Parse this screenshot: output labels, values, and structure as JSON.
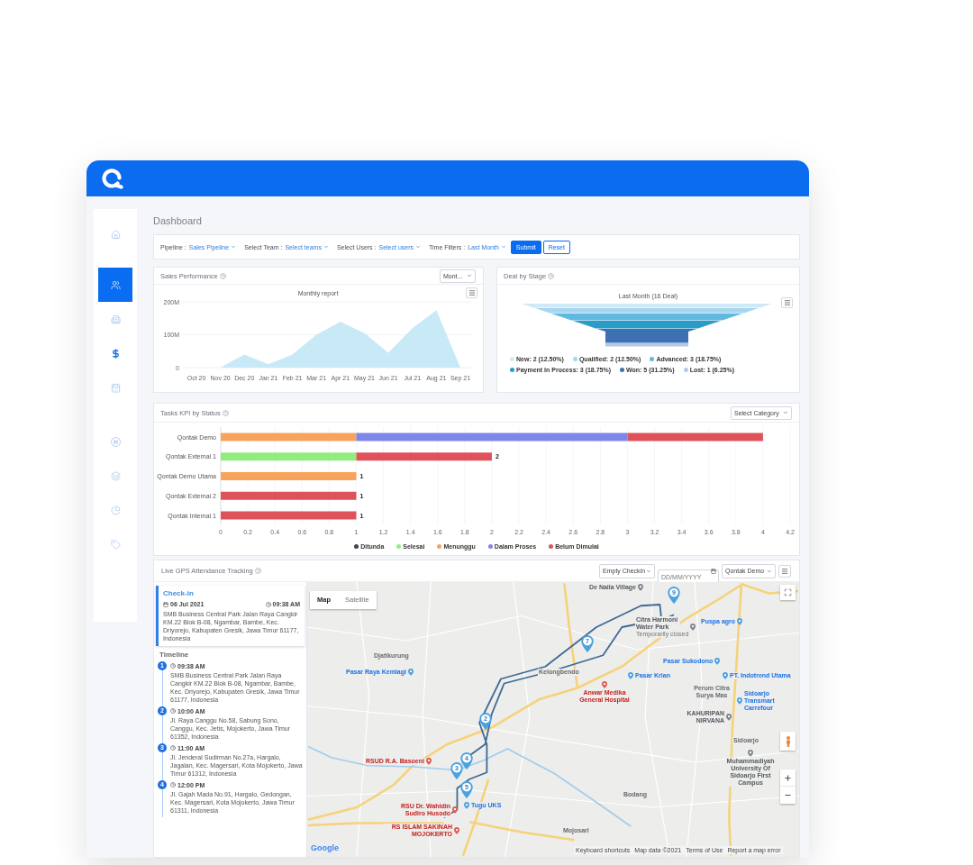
{
  "sidebar": {
    "items": [
      {
        "kind": "home",
        "selected": false
      },
      {
        "kind": "users",
        "selected": true
      },
      {
        "kind": "building",
        "selected": false
      },
      {
        "kind": "dollar",
        "selected": false
      },
      {
        "kind": "calendar",
        "selected": false
      },
      {
        "kind": "list",
        "selected": false
      },
      {
        "kind": "layers",
        "selected": false
      },
      {
        "kind": "pie",
        "selected": false
      },
      {
        "kind": "tag",
        "selected": false
      }
    ]
  },
  "page_title": "Dashboard",
  "filters": {
    "fields": [
      {
        "label": "Pipeline :",
        "value": "Sales Pipeline"
      },
      {
        "label": "Select Team :",
        "value": "Select teams"
      },
      {
        "label": "Select Users :",
        "value": "Select users"
      },
      {
        "label": "Time Filters :",
        "value": "Last Month"
      }
    ],
    "buttons": [
      {
        "label": "Submit",
        "kind": "primary"
      },
      {
        "label": "Reset",
        "kind": "secondary"
      }
    ]
  },
  "sales_performance": {
    "title": "Sales Performance",
    "period_select": "Mont...",
    "chart_data": {
      "type": "area",
      "title": "Monthly report",
      "categories": [
        "Oct 20",
        "Nov 20",
        "Dec 20",
        "Jan 21",
        "Feb 21",
        "Mar 21",
        "Apr 21",
        "May 21",
        "Jun 21",
        "Jul 21",
        "Aug 21",
        "Sep 21"
      ],
      "series": [
        {
          "color": "#c8e9f6",
          "values": [
            0,
            0,
            40,
            10,
            40,
            100,
            140,
            105,
            45,
            120,
            175,
            0
          ]
        }
      ],
      "ylim": [
        0,
        200
      ],
      "yticks": [
        {
          "value": 0,
          "label": "0"
        },
        {
          "value": 100,
          "label": "100M"
        },
        {
          "value": 200,
          "label": "200M"
        }
      ],
      "grid": true
    }
  },
  "deal_by_stage": {
    "title": "Deal by Stage",
    "chart_title": "Last Month (16 Deal)",
    "stages": [
      {
        "label": "New: 2 (12.50%)",
        "color": "#cfe9f7"
      },
      {
        "label": "Qualified: 2 (12.50%)",
        "color": "#a6d7f0"
      },
      {
        "label": "Advanced: 3 (18.75%)",
        "color": "#62b9e0"
      },
      {
        "label": "Payment In Process: 3 (18.75%)",
        "color": "#2b9cc8"
      },
      {
        "label": "Won: 5 (31.25%)",
        "color": "#3d71b3"
      },
      {
        "label": "Lost: 1 (6.25%)",
        "color": "#b6c9e4"
      }
    ]
  },
  "tasks_kpi": {
    "title": "Tasks KPI by Status",
    "category_select": "Select Category",
    "chart_data": {
      "type": "bar",
      "orientation": "horizontal",
      "stacked": true,
      "categories": [
        "Qontak Demo",
        "Qontak External 1",
        "Qontak Demo Utama",
        "Qontak External 2",
        "Qontak Internal 1"
      ],
      "series": [
        {
          "name": "Ditunda",
          "color": "#434348",
          "values": [
            0,
            0,
            0,
            0,
            0
          ]
        },
        {
          "name": "Selesai",
          "color": "#90ed7d",
          "values": [
            0,
            1,
            0,
            0,
            0
          ]
        },
        {
          "name": "Menunggu",
          "color": "#f7a35c",
          "values": [
            1,
            0,
            1,
            0,
            0
          ]
        },
        {
          "name": "Dalam Proses",
          "color": "#8085e9",
          "values": [
            2,
            0,
            0,
            0,
            0
          ]
        },
        {
          "name": "Belum Dimulai",
          "color": "#e0525a",
          "values": [
            1,
            1,
            0,
            1,
            1
          ]
        }
      ],
      "xlim": [
        0,
        4.2
      ],
      "xticks": [
        0,
        0.2,
        0.4,
        0.6,
        0.8,
        1,
        1.2,
        1.4,
        1.6,
        1.8,
        2,
        2.2,
        2.4,
        2.6,
        2.8,
        3,
        3.2,
        3.4,
        3.6,
        3.8,
        4,
        4.2
      ],
      "value_labels": [
        null,
        "2",
        "1",
        "1",
        "1"
      ],
      "grid": true
    }
  },
  "gps_tracking": {
    "title": "Live GPS Attendance Tracking",
    "checkin_filter": "Empty Checkin",
    "date_field": {
      "placeholder": "DD/MM/YYYY"
    },
    "user_select": "Qontak Demo",
    "checkin": {
      "title": "Check-in",
      "date": "06 Jul 2021",
      "time": "09:38 AM",
      "address": "SMB Business Central Park Jalan Raya Cangkir KM.22 Blok B-08, Ngambar, Bambe, Kec. Driyorejo, Kabupaten Gresik, Jawa Timur 61177, Indonesia"
    },
    "timeline": {
      "title": "Timeline",
      "entries": [
        {
          "number": "1",
          "time": "09:38 AM",
          "address": "SMB Business Central Park Jalan Raya Cangkir KM.22 Blok B-08, Ngambar, Bambe, Kec. Driyorejo, Kabupaten Gresik, Jawa Timur 61177, Indonesia"
        },
        {
          "number": "2",
          "time": "10:00 AM",
          "address": "Jl. Raya Canggu No.58, Sabung Sono, Canggu, Kec. Jetis, Mojokerto, Jawa Timur 61352, Indonesia"
        },
        {
          "number": "3",
          "time": "11:00 AM",
          "address": "Jl. Jenderal Sudirman No.27a, Hargalo, Jagalan, Kec. Magersari, Kota Mojokerto, Jawa Timur 61312, Indonesia"
        },
        {
          "number": "4",
          "time": "12:00 PM",
          "address": "Jl. Gajah Mada No.91, Hargalo, Gedongan, Kec. Magersari, Kota Mojokerto, Jawa Timur 61311, Indonesia"
        }
      ]
    },
    "map": {
      "tabs": [
        {
          "label": "Map",
          "selected": true
        },
        {
          "label": "Satellite",
          "selected": false
        }
      ],
      "places": [
        {
          "name": "De Naila Village",
          "kind": "landmark"
        },
        {
          "name": "Citra Harmoni Water Park",
          "kind": "landmark",
          "note": "Temporarily closed"
        },
        {
          "name": "Puspa agro",
          "kind": "shop"
        },
        {
          "name": "Djatikurung",
          "kind": "area"
        },
        {
          "name": "Pasar Raya Kemlagi",
          "kind": "shop"
        },
        {
          "name": "Kelongbendo",
          "kind": "area"
        },
        {
          "name": "Anwar Medika General Hospital",
          "kind": "hospital"
        },
        {
          "name": "Pasar Krian",
          "kind": "shop"
        },
        {
          "name": "Pasar Sukodono",
          "kind": "shop"
        },
        {
          "name": "Perum Citra Surya Mas",
          "kind": "area"
        },
        {
          "name": "PT. Indotrend Utama",
          "kind": "shop"
        },
        {
          "name": "KAHURIPAN NIRVANA",
          "kind": "landmark"
        },
        {
          "name": "Sidoarjo Transmart Carrefour",
          "kind": "shop"
        },
        {
          "name": "Sidoarjo",
          "kind": "area"
        },
        {
          "name": "RSUD R.A. Basoeni",
          "kind": "hospital"
        },
        {
          "name": "Muhammadiyah University Of Sidoarjo First Campus",
          "kind": "landmark"
        },
        {
          "name": "Bodang",
          "kind": "area"
        },
        {
          "name": "Tugu UKS",
          "kind": "shop"
        },
        {
          "name": "RSU Dr. Wahidin Sudiro Husodo",
          "kind": "hospital"
        },
        {
          "name": "RS ISLAM SAKINAH MOJOKERTO",
          "kind": "hospital"
        },
        {
          "name": "Mojosari",
          "kind": "area"
        }
      ],
      "markers": [
        "9",
        "7",
        "2",
        "4",
        "3",
        "5"
      ],
      "attribution": [
        "Keyboard shortcuts",
        "Map data ©2021",
        "Terms of Use",
        "Report a map error"
      ],
      "logo": "Google"
    }
  }
}
